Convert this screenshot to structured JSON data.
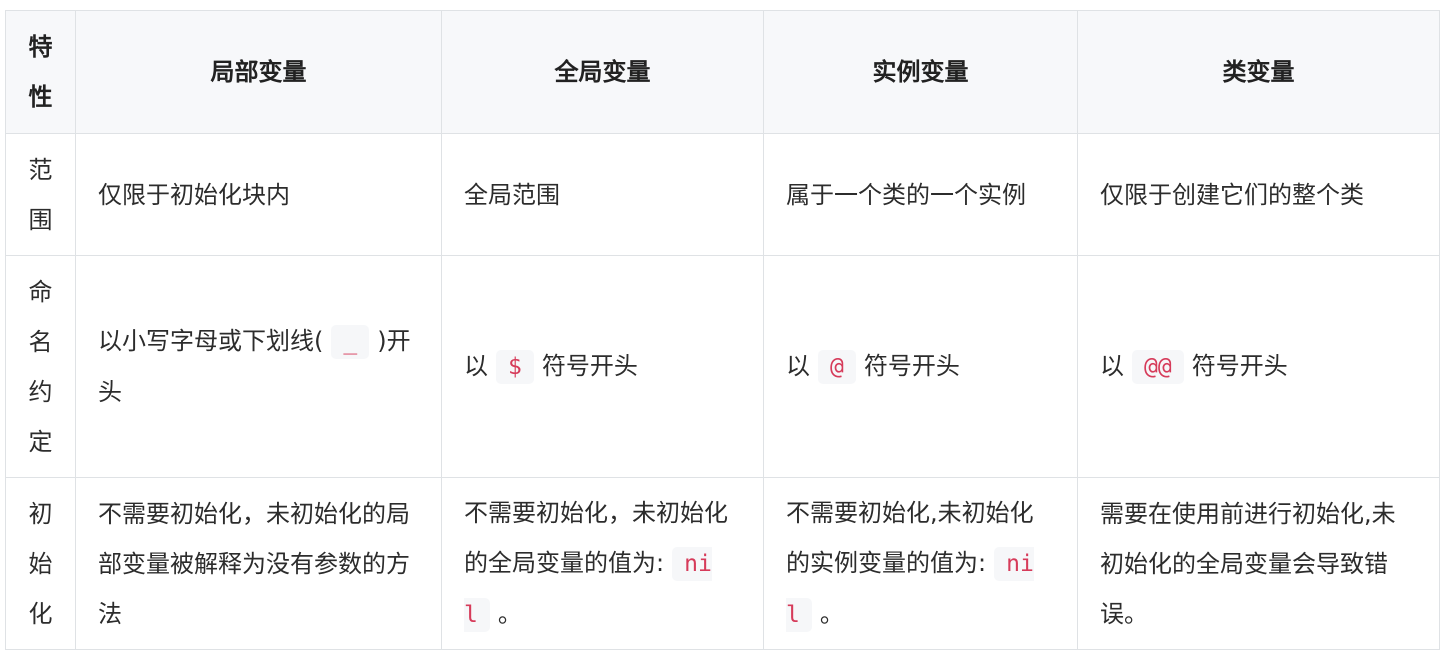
{
  "table": {
    "headers": [
      "特\n性",
      "局部变量",
      "全局变量",
      "实例变量",
      "类变量"
    ],
    "rows": [
      {
        "feature": "范\n围",
        "cells": [
          {
            "text": "仅限于初始化块内"
          },
          {
            "text": "全局范围"
          },
          {
            "text": "属于一个类的一个实例"
          },
          {
            "text": "仅限于创建它们的整个类"
          }
        ]
      },
      {
        "feature": "命\n名\n约\n定",
        "cells": [
          {
            "prefix": "以小写字母或下划线(",
            "code": "_",
            "suffix": ")开头"
          },
          {
            "prefix": "以",
            "code": "$",
            "suffix": "符号开头"
          },
          {
            "prefix": "以",
            "code": "@",
            "suffix": "符号开头"
          },
          {
            "prefix": "以",
            "code": "@@",
            "suffix": "符号开头"
          }
        ]
      },
      {
        "feature": "初\n始\n化",
        "cells": [
          {
            "text": "不需要初始化，未初始化的局部变量被解释为没有参数的方法"
          },
          {
            "prefix": "不需要初始化，未初始化的全局变量的值为:",
            "code": "nil",
            "suffix": "。"
          },
          {
            "prefix": "不需要初始化,未初始化的实例变量的值为:",
            "code": "nil",
            "suffix": "。"
          },
          {
            "text": "需要在使用前进行初始化,未初始化的全局变量会导致错误。"
          }
        ]
      }
    ]
  }
}
